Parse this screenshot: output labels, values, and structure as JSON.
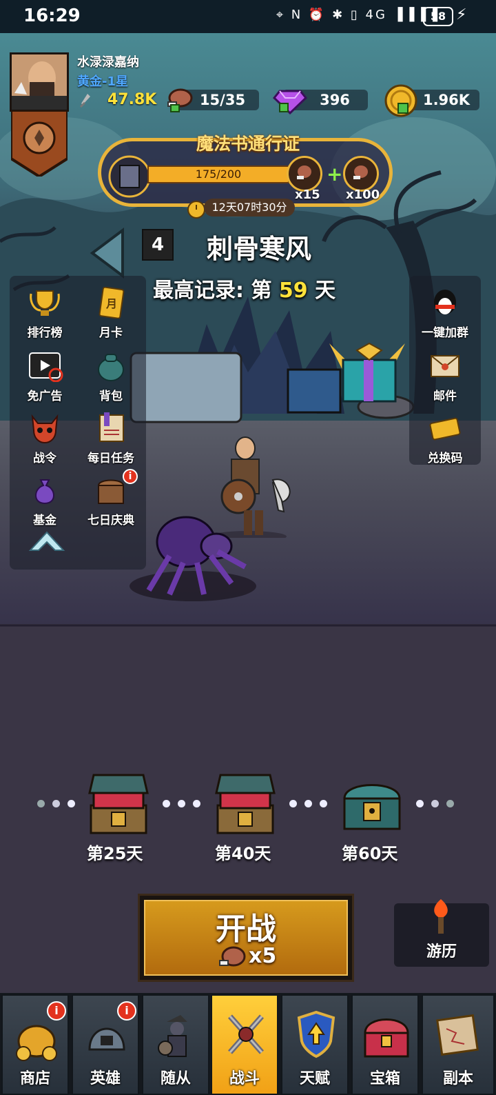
{
  "status_bar": {
    "time": "16:29",
    "icons": "⌖ N ⏰ ✱ ▯ 4G ▐▐▐▐",
    "battery": "58"
  },
  "player": {
    "name": "水渌渌嘉纳",
    "rank": "黄金-1星",
    "power": "47.8K"
  },
  "resources": {
    "stamina": "15/35",
    "gems": "396",
    "coins": "1.96K"
  },
  "pass": {
    "title": "魔法书通行证",
    "progress_text": "175/200",
    "progress_fraction": 0.875,
    "reward1": "x15",
    "reward2": "x100",
    "timer": "12天07时30分"
  },
  "stage": {
    "number": "4",
    "name": "刺骨寒风",
    "record_prefix": "最高记录: 第",
    "record_day": "59",
    "record_suffix": "天"
  },
  "left_menu": [
    {
      "label": "排行榜"
    },
    {
      "label": "月卡"
    },
    {
      "label": "免广告"
    },
    {
      "label": "背包"
    },
    {
      "label": "战令"
    },
    {
      "label": "每日任务"
    },
    {
      "label": "基金"
    },
    {
      "label": "七日庆典",
      "badge": "i"
    }
  ],
  "right_menu": [
    {
      "label": "一键加群"
    },
    {
      "label": "邮件"
    },
    {
      "label": "兑换码"
    }
  ],
  "month_card_glyph": "月",
  "milestones": [
    {
      "label": "第25天"
    },
    {
      "label": "第40天"
    },
    {
      "label": "第60天"
    }
  ],
  "fight_button": {
    "label": "开战",
    "cost": "x5"
  },
  "travel_button": {
    "label": "游历"
  },
  "nav_tabs": [
    {
      "label": "商店",
      "badge": "i"
    },
    {
      "label": "英雄",
      "badge": "i"
    },
    {
      "label": "随从"
    },
    {
      "label": "战斗",
      "active": true
    },
    {
      "label": "天赋"
    },
    {
      "label": "宝箱"
    },
    {
      "label": "副本"
    }
  ],
  "colors": {
    "accent_gold": "#e9b43a",
    "record_day": "#ffe23a",
    "rank_blue": "#4fa8ff",
    "badge_red": "#e3321e"
  }
}
